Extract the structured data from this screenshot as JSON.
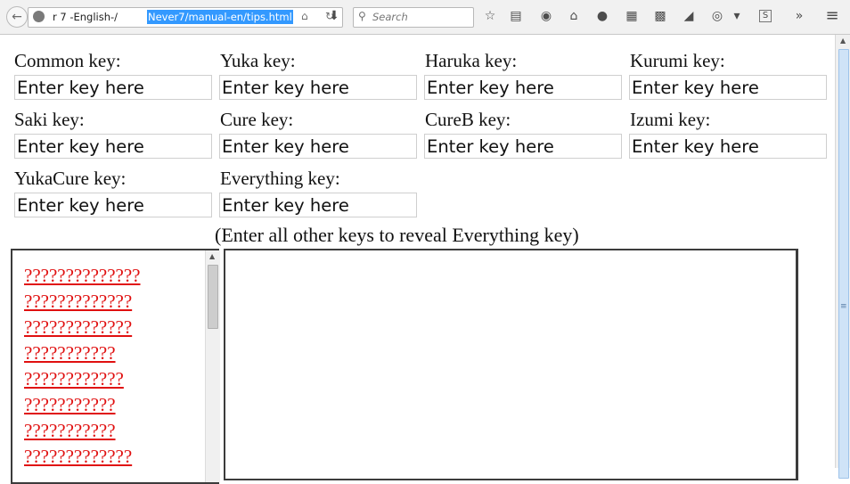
{
  "browser": {
    "url_prefix": "r 7 -English-/",
    "url_selected": "Never7/manual-en/tips.html",
    "search_placeholder": "Search",
    "icons": {
      "back": "←",
      "home_small": "⌂",
      "reload": "↻",
      "download": "⬇",
      "search": "⚲",
      "bookmark": "☆",
      "reader": "▤",
      "pocket": "◉",
      "home": "⌂",
      "hint": "●",
      "grid": "▦",
      "qr": "▩",
      "send": "◢",
      "eye": "◎",
      "dropdown": "▾",
      "s_box": "S",
      "more": "»",
      "menu": "≡"
    }
  },
  "keys": {
    "placeholder": "Enter key here",
    "common": "Common key:",
    "yuka": "Yuka key:",
    "haruka": "Haruka key:",
    "kurumi": "Kurumi key:",
    "saki": "Saki key:",
    "cure": "Cure key:",
    "cureb": "CureB key:",
    "izumi": "Izumi key:",
    "yukacure": "YukaCure key:",
    "everything": "Everything key:"
  },
  "hint": "(Enter all other keys to reveal Everything key)",
  "links": [
    "??????????????",
    "?????????????",
    "?????????????",
    "???????????",
    "????????????",
    "???????????",
    "???????????",
    "?????????????"
  ],
  "scroll": {
    "up_arrow": "▲",
    "grip": "≡"
  }
}
